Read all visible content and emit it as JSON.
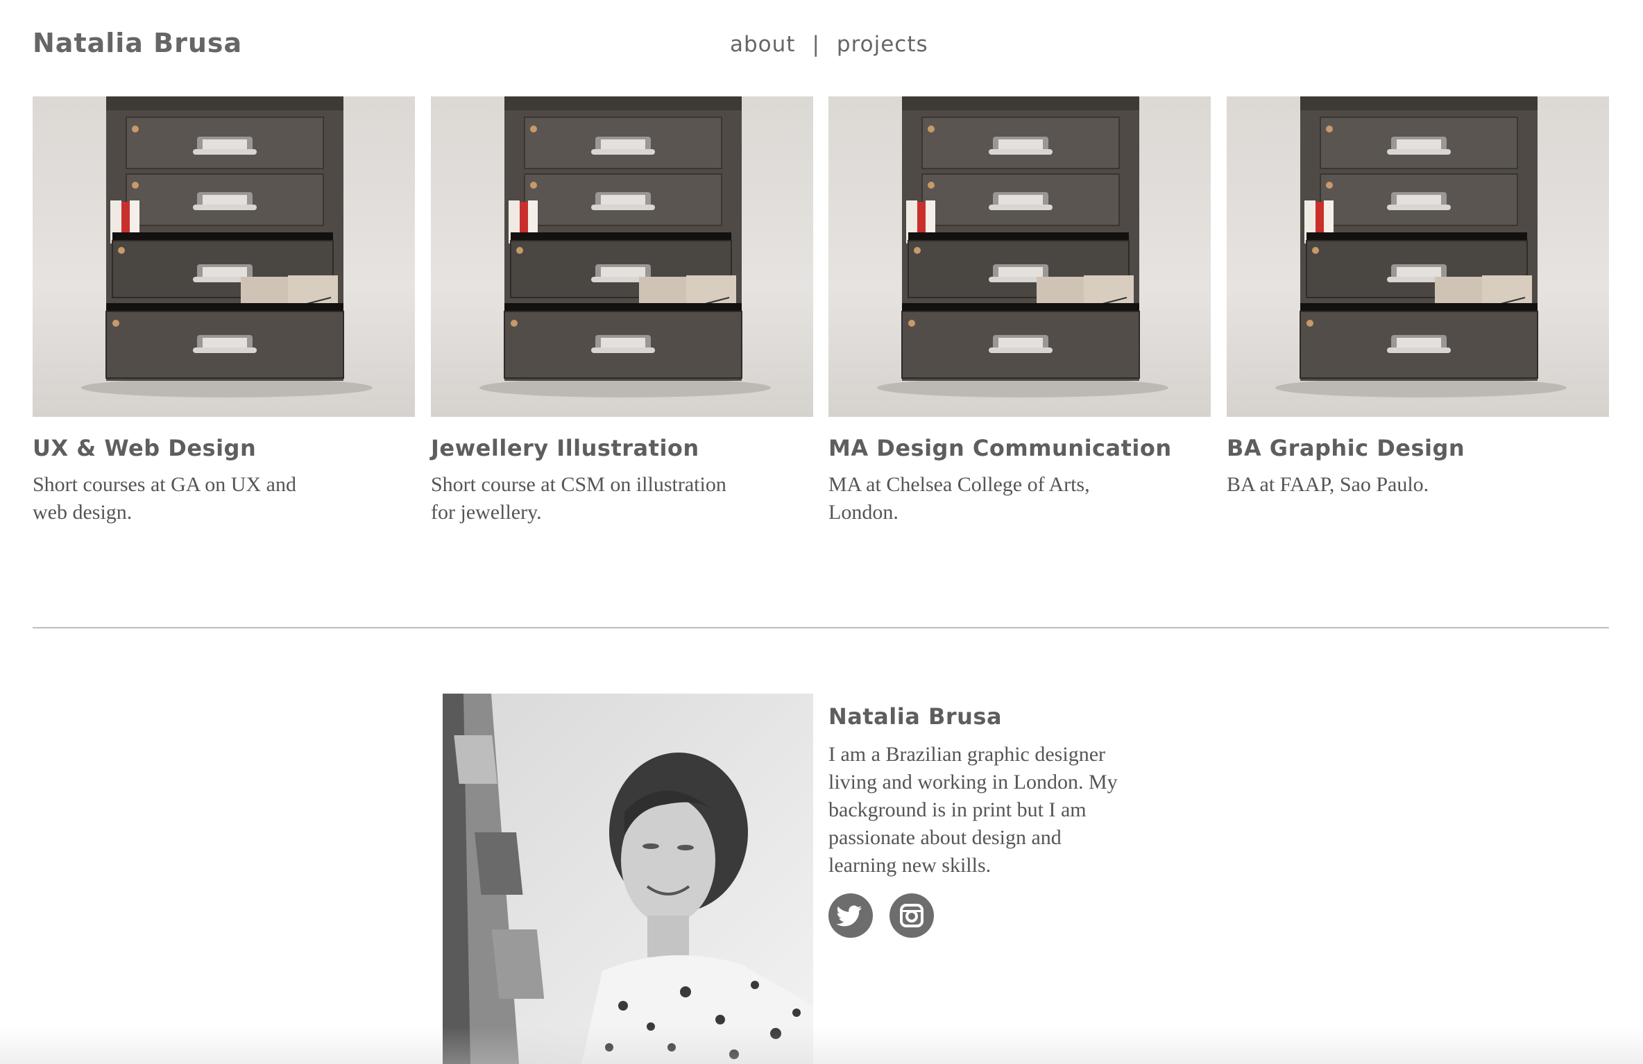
{
  "header": {
    "site_title": "Natalia Brusa",
    "nav": {
      "about": "about",
      "separator": "|",
      "projects": "projects"
    }
  },
  "projects": [
    {
      "title": "UX & Web Design",
      "description": "Short courses at GA on UX and web design.",
      "image": "filing-cabinet-photo"
    },
    {
      "title": "Jewellery Illustration",
      "description": "Short course at CSM on illustration for jewellery.",
      "image": "filing-cabinet-photo"
    },
    {
      "title": "MA Design Communication",
      "description": "MA at Chelsea College of Arts, London.",
      "image": "filing-cabinet-photo"
    },
    {
      "title": "BA Graphic Design",
      "description": "BA at FAAP, Sao Paulo.",
      "image": "filing-cabinet-photo"
    }
  ],
  "about": {
    "name": "Natalia Brusa",
    "bio": "I am a Brazilian graphic designer living and working in London. My background is in print but I am passionate about design and learning new skills.",
    "portrait": "black-and-white-portrait-photo",
    "social": [
      {
        "icon": "twitter-icon"
      },
      {
        "icon": "instagram-icon"
      }
    ]
  },
  "colors": {
    "text": "#5e5e5e",
    "divider": "#bdbdbd",
    "cabinet": "#4f4a46",
    "photo_background": "#e2dfdc"
  }
}
